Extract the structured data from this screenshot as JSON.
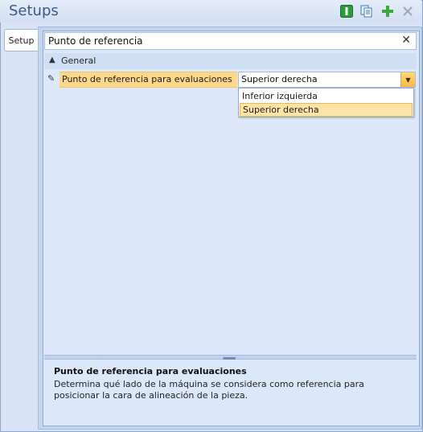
{
  "window": {
    "title": "Setups"
  },
  "toolbar": {
    "icons": [
      "info-icon",
      "copy-icon",
      "add-icon",
      "close-icon"
    ],
    "colors": {
      "info": "#2e9b3a",
      "add": "#3aa83a",
      "copy": "#3a78c2",
      "close": "#9aa7b8"
    }
  },
  "tabs": [
    {
      "label": "Setup"
    }
  ],
  "search": {
    "value": "Punto de referencia",
    "clear_glyph": "✕"
  },
  "category": {
    "label": "General"
  },
  "property": {
    "name": "Punto de referencia para evaluaciones",
    "value": "Superior derecha"
  },
  "dropdown": {
    "options": [
      "Inferior izquierda",
      "Superior derecha"
    ],
    "selected": "Superior derecha"
  },
  "description": {
    "title": "Punto de referencia para evaluaciones",
    "text": "Determina qué lado de la máquina se considera como referencia para posicionar la cara de alineación de la pieza."
  }
}
